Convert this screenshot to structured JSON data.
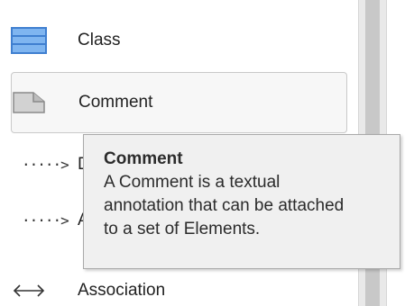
{
  "palette": {
    "items": [
      {
        "label": "Class",
        "icon": "class-icon"
      },
      {
        "label": "Comment",
        "icon": "comment-icon"
      },
      {
        "label": "D",
        "icon": "dependency-arrow-icon"
      },
      {
        "label": "A",
        "icon": "abstraction-arrow-icon"
      },
      {
        "label": "Association",
        "icon": "association-arrow-icon"
      }
    ],
    "dotted_arrow_glyph": "·····>"
  },
  "tooltip": {
    "title": "Comment",
    "body": "A Comment is a textual\nannotation that can be attached\nto a set of Elements."
  },
  "colors": {
    "class_icon_fill": "#7fb5f0",
    "class_icon_stroke": "#3f7fd0",
    "comment_icon_fill": "#c8c8c8",
    "tooltip_bg": "#f0f0f0"
  }
}
